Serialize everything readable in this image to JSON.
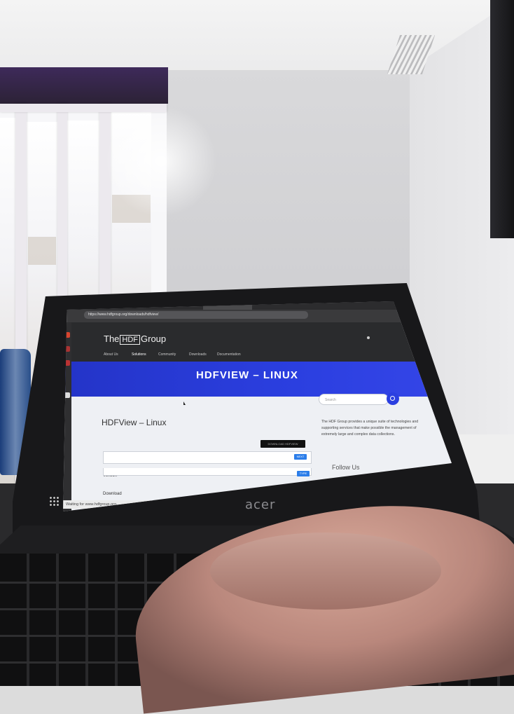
{
  "browser": {
    "tab_title": "HDFView - Linux",
    "url": "https://www.hdfgroup.org/downloads/hdfview/",
    "status": "Waiting for www.hdfgroup.org..."
  },
  "site": {
    "logo_prefix": "The",
    "logo_mark": "HDF",
    "logo_suffix": "Group",
    "nav": [
      "About Us",
      "Solutions",
      "Community",
      "Downloads",
      "Documentation"
    ],
    "banner_title": "HDFVIEW – LINUX",
    "page_title": "HDFView – Linux",
    "download_button": "DOWNLOAD HDFVIEW",
    "version_label": "Version",
    "download_label": "Download",
    "chip_1": "NEXT",
    "chip_2": "TYPE"
  },
  "aside": {
    "search_placeholder": "Search",
    "about_text": "The HDF Group provides a unique suite of technologies and supporting services that make possible the management of extremely large and complex data collections.",
    "follow_heading": "Follow Us"
  },
  "device": {
    "brand": "acer"
  },
  "colors": {
    "banner": "#2b3fe0",
    "site_header": "#2a2b2d",
    "chip": "#2b7de9"
  }
}
